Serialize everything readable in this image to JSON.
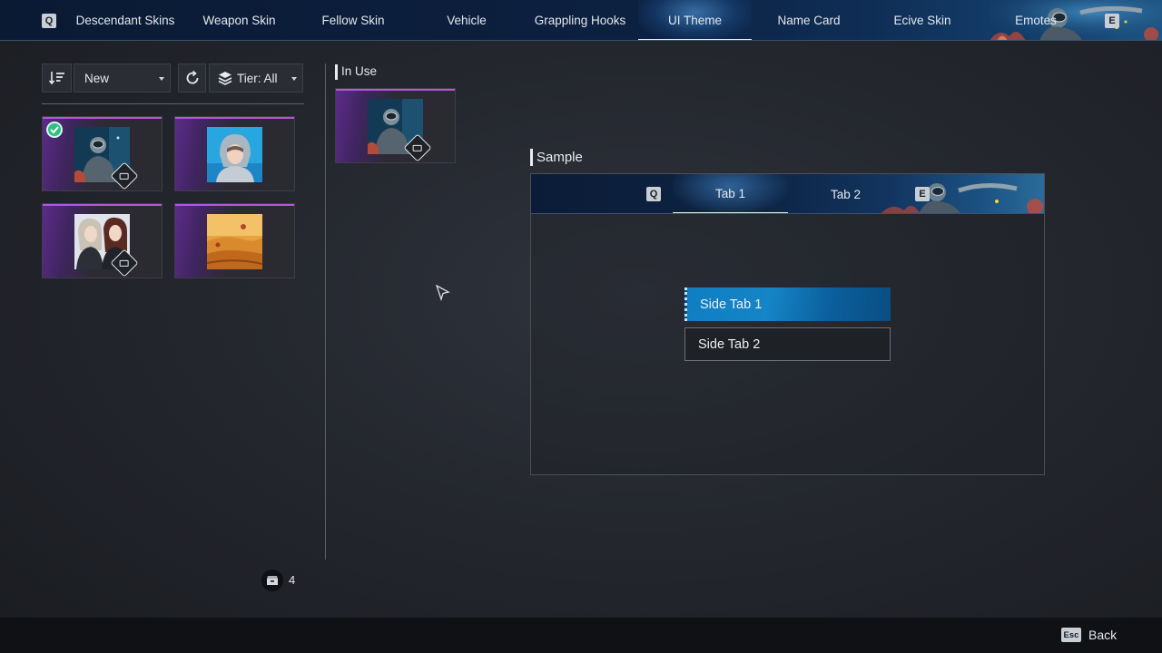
{
  "nav": {
    "prev_key": "Q",
    "next_key": "E",
    "tabs": [
      {
        "label": "Descendant Skins"
      },
      {
        "label": "Weapon Skin"
      },
      {
        "label": "Fellow Skin"
      },
      {
        "label": "Vehicle"
      },
      {
        "label": "Grappling Hooks"
      },
      {
        "label": "UI Theme"
      },
      {
        "label": "Name Card"
      },
      {
        "label": "Ecive Skin"
      },
      {
        "label": "Emotes"
      }
    ],
    "active_tab": "UI Theme"
  },
  "filters": {
    "sort_icon": "sort-descending-icon",
    "sort_value": "New",
    "reset_icon": "refresh-icon",
    "tier_icon": "layers-icon",
    "tier_value": "Tier: All"
  },
  "items": [
    {
      "theme": "underwater-diver",
      "equipped": true,
      "has_ui_badge": true
    },
    {
      "theme": "hooded-girl-blue",
      "equipped": false,
      "has_ui_badge": false
    },
    {
      "theme": "two-women",
      "equipped": false,
      "has_ui_badge": true
    },
    {
      "theme": "autumn-field",
      "equipped": false,
      "has_ui_badge": false
    }
  ],
  "inventory": {
    "icon": "storage-box-icon",
    "count": "4"
  },
  "in_use": {
    "label": "In Use",
    "theme": "underwater-diver"
  },
  "sample": {
    "label": "Sample",
    "prev_key": "Q",
    "next_key": "E",
    "tabs": [
      {
        "label": "Tab 1"
      },
      {
        "label": "Tab 2"
      }
    ],
    "side_tabs": [
      {
        "label": "Side Tab 1"
      },
      {
        "label": "Side Tab 2"
      }
    ]
  },
  "footer": {
    "key": "Esc",
    "label": "Back"
  },
  "colors": {
    "accent_purple": "#b456e0",
    "side_tab_active": "#1585c7",
    "equipped_check": "#2fbf82"
  }
}
